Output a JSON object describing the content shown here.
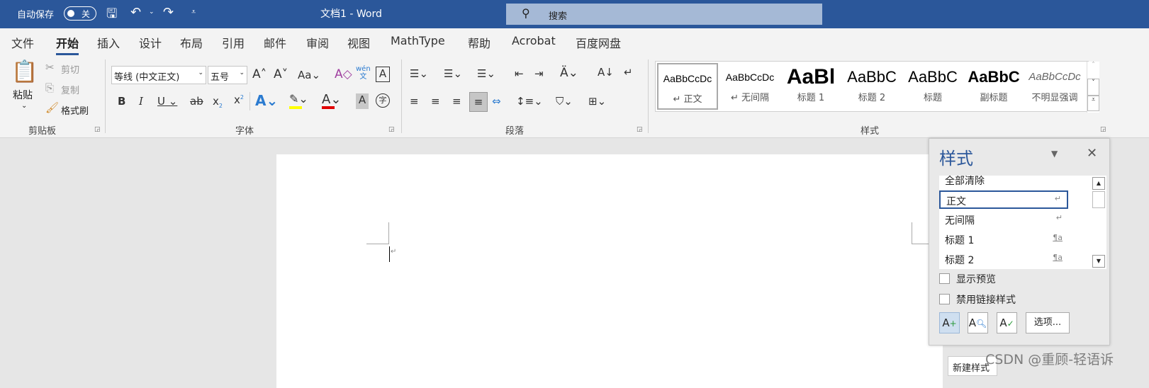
{
  "titlebar": {
    "autosave_label": "自动保存",
    "autosave_state": "关",
    "doc_title": "文档1  -  Word",
    "search_placeholder": "搜索"
  },
  "tabs": [
    "文件",
    "开始",
    "插入",
    "设计",
    "布局",
    "引用",
    "邮件",
    "审阅",
    "视图",
    "MathType",
    "帮助",
    "Acrobat",
    "百度网盘"
  ],
  "active_tab": "开始",
  "clipboard": {
    "paste": "粘贴",
    "cut": "剪切",
    "copy": "复制",
    "format_painter": "格式刷",
    "label": "剪贴板"
  },
  "font": {
    "name": "等线 (中文正文)",
    "size": "五号",
    "label": "字体",
    "highlight_color": "#ffff00",
    "font_color": "#e00000"
  },
  "paragraph": {
    "label": "段落"
  },
  "styles_gallery": {
    "label": "样式",
    "items": [
      {
        "preview": "AaBbCcDc",
        "name": "↵ 正文"
      },
      {
        "preview": "AaBbCcDc",
        "name": "↵ 无间隔"
      },
      {
        "preview": "AaBl",
        "name": "标题 1"
      },
      {
        "preview": "AaBbC",
        "name": "标题 2"
      },
      {
        "preview": "AaBbC",
        "name": "标题"
      },
      {
        "preview": "AaBbC",
        "name": "副标题"
      },
      {
        "preview": "AaBbCcDc",
        "name": "不明显强调"
      }
    ]
  },
  "styles_pane": {
    "title": "样式",
    "items": [
      {
        "name": "全部清除",
        "mark": ""
      },
      {
        "name": "正文",
        "mark": "↵"
      },
      {
        "name": "无间隔",
        "mark": "↵"
      },
      {
        "name": "标题 1",
        "mark": "¶a"
      },
      {
        "name": "标题 2",
        "mark": "¶a"
      }
    ],
    "show_preview": "显示预览",
    "disable_linked": "禁用链接样式",
    "options": "选项...",
    "tooltip": "新建样式"
  },
  "watermark": "CSDN @重顾-轻语诉",
  "colors": {
    "accent": "#2b579a"
  }
}
